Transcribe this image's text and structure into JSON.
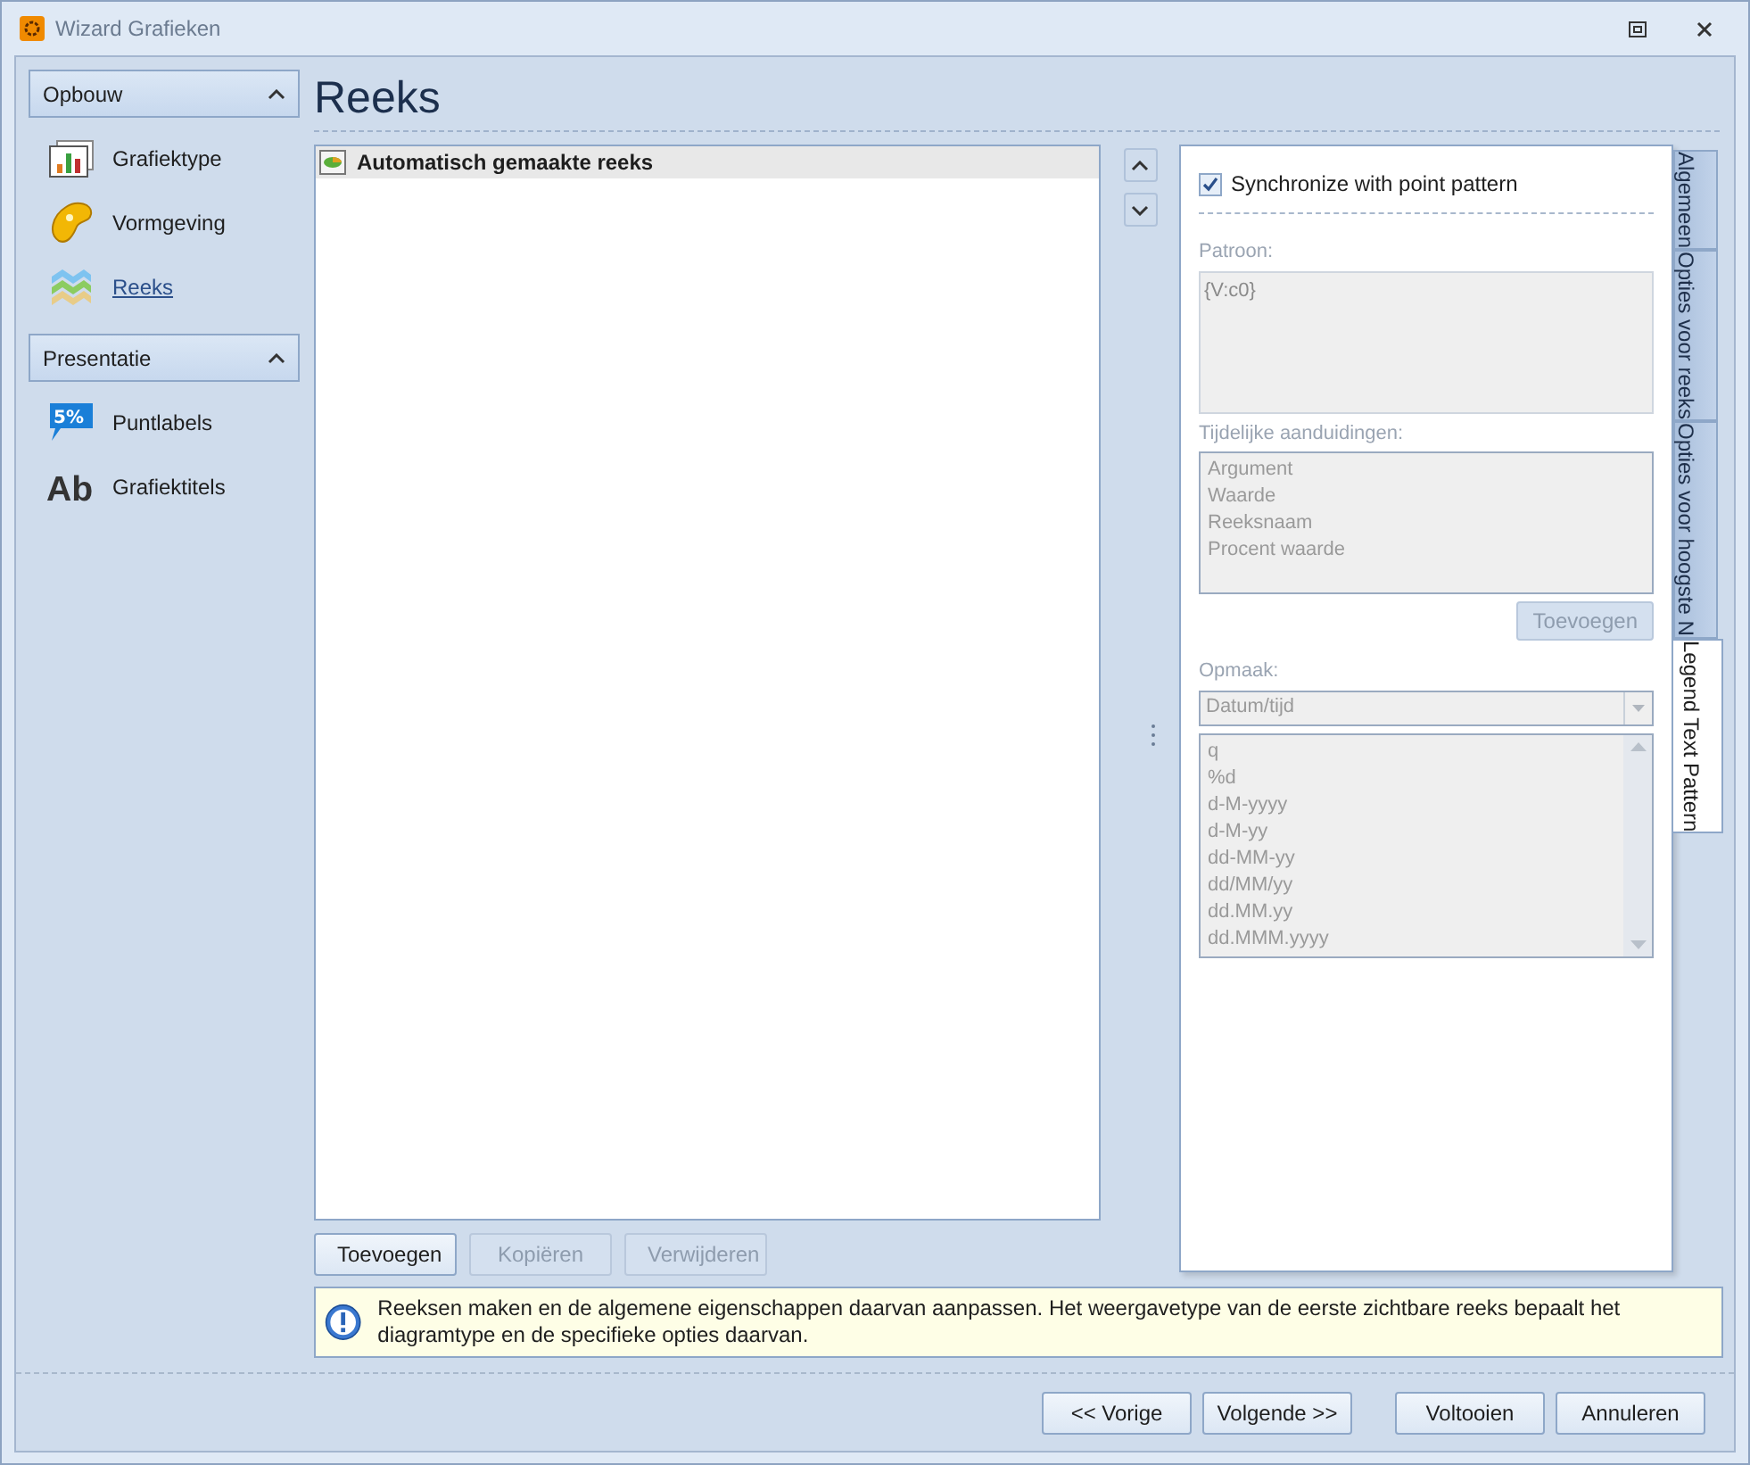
{
  "window": {
    "title": "Wizard Grafieken"
  },
  "sidebar": {
    "groups": [
      {
        "title": "Opbouw",
        "expanded": true,
        "items": [
          {
            "label": "Grafiektype",
            "kind": "chart",
            "selected": false
          },
          {
            "label": "Vormgeving",
            "kind": "palette",
            "selected": false
          },
          {
            "label": "Reeks",
            "kind": "series",
            "selected": true
          }
        ]
      },
      {
        "title": "Presentatie",
        "expanded": true,
        "items": [
          {
            "label": "Puntlabels",
            "kind": "label",
            "icon_text": "5%",
            "selected": false
          },
          {
            "label": "Grafiektitels",
            "kind": "titles",
            "icon_text": "Ab",
            "selected": false
          }
        ]
      }
    ]
  },
  "page_title": "Reeks",
  "series_list": [
    {
      "label": "Automatisch gemaakte reeks",
      "selected": true
    }
  ],
  "list_buttons": [
    {
      "label": "Toevoegen",
      "disabled": false
    },
    {
      "label": "Kopiëren",
      "disabled": true
    },
    {
      "label": "Verwijderen",
      "disabled": true
    }
  ],
  "tabs": [
    {
      "label": "Algemeen",
      "selected": false
    },
    {
      "label": "Opties voor reeks",
      "selected": false
    },
    {
      "label": "Opties voor hoogste N",
      "selected": false
    },
    {
      "label": "Legend Text Pattern",
      "selected": true
    }
  ],
  "panel": {
    "sync": {
      "label": "Synchronize with point pattern",
      "checked": true
    },
    "pattern_label": "Patroon:",
    "pattern_value": "{V:c0}",
    "placeholders_label": "Tijdelijke aanduidingen:",
    "placeholders": [
      "Argument",
      "Waarde",
      "Reeksnaam",
      "Procent waarde"
    ],
    "add_button": {
      "label": "Toevoegen",
      "disabled": true
    },
    "format_label": "Opmaak:",
    "format_value": "Datum/tijd",
    "formats": [
      "q",
      "%d",
      "d-M-yyyy",
      "d-M-yy",
      "dd-MM-yy",
      "dd/MM/yy",
      "dd.MM.yy",
      "dd.MMM.yyyy"
    ]
  },
  "info": "Reeksen maken en de algemene eigenschappen daarvan aanpassen. Het weergavetype van de eerste zichtbare reeks bepaalt het diagramtype en de specifieke opties daarvan.",
  "footer_buttons": [
    {
      "label": "<< Vorige"
    },
    {
      "label": "Volgende >>"
    },
    {
      "label": "Voltooien"
    },
    {
      "label": "Annuleren"
    }
  ]
}
